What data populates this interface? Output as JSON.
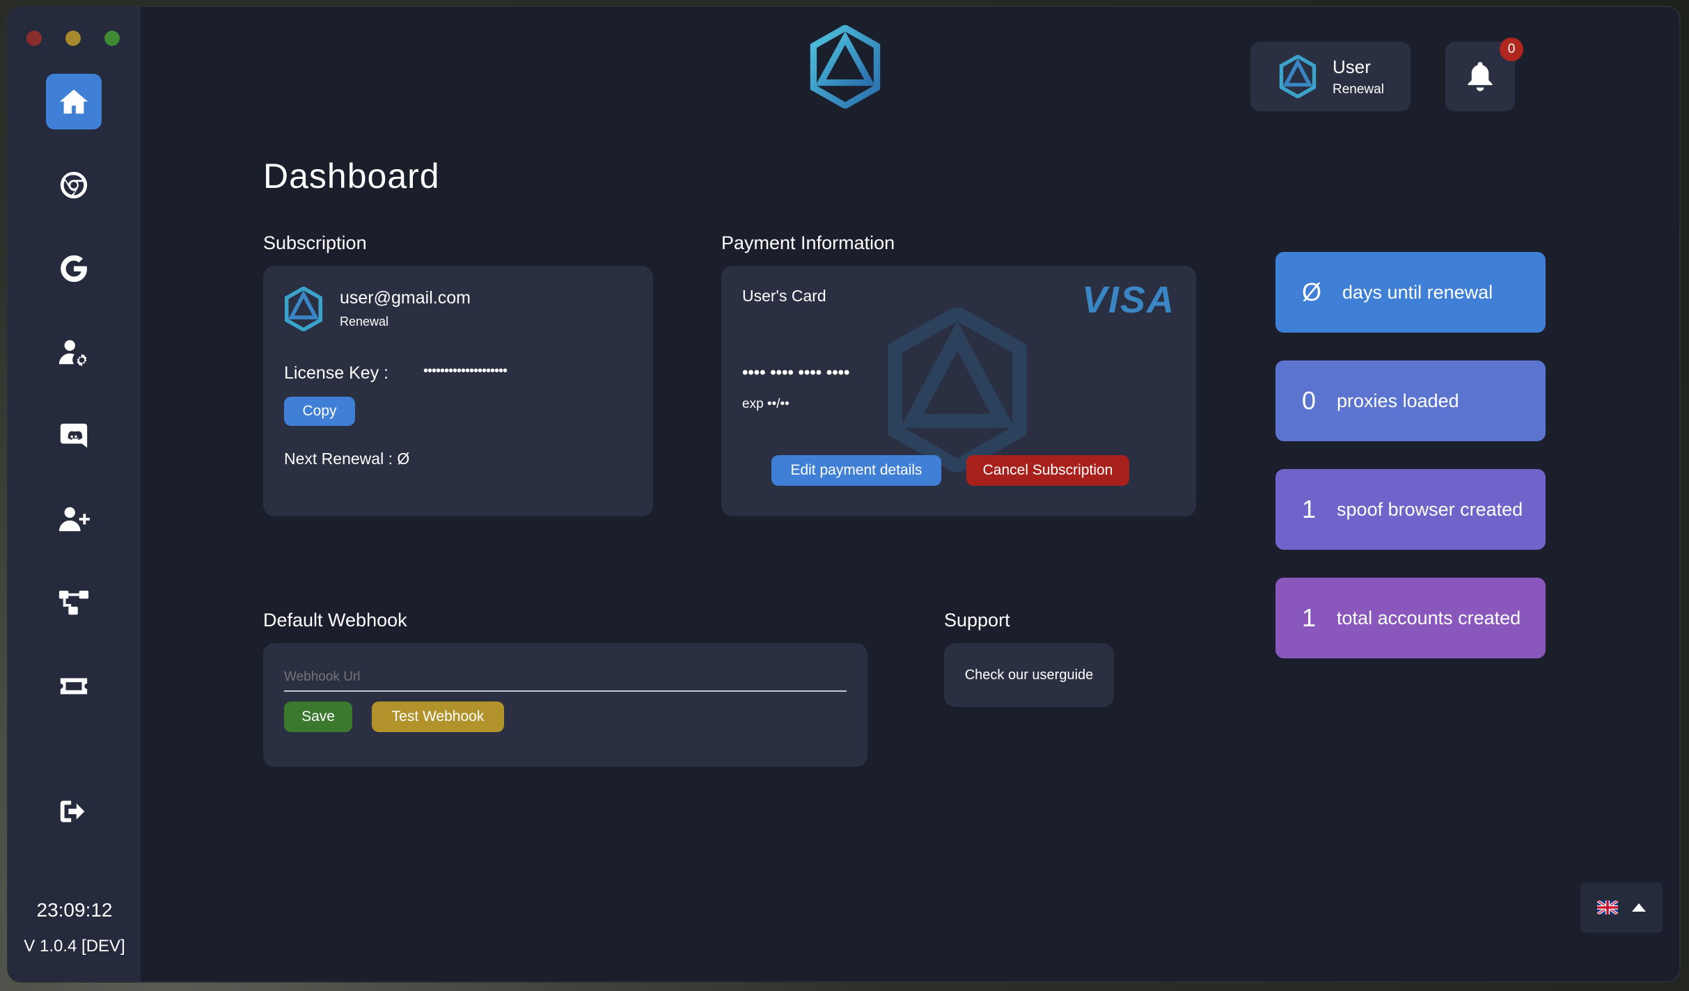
{
  "sidebar": {
    "items": [
      {
        "name": "home",
        "icon": "home-icon",
        "active": true
      },
      {
        "name": "browser",
        "icon": "chrome-icon",
        "active": false
      },
      {
        "name": "google",
        "icon": "google-icon",
        "active": false
      },
      {
        "name": "account-settings",
        "icon": "user-gear-icon",
        "active": false
      },
      {
        "name": "discord",
        "icon": "discord-icon",
        "active": false
      },
      {
        "name": "add-user",
        "icon": "user-plus-icon",
        "active": false
      },
      {
        "name": "workflow",
        "icon": "sitemap-icon",
        "active": false
      },
      {
        "name": "tickets",
        "icon": "ticket-icon",
        "active": false
      },
      {
        "name": "logout",
        "icon": "sign-out-icon",
        "active": false
      }
    ],
    "clock": "23:09:12",
    "version": "V 1.0.4 [DEV]"
  },
  "header": {
    "user_name": "User",
    "user_role": "Renewal",
    "notifications_count": "0"
  },
  "page_title": "Dashboard",
  "subscription": {
    "section_label": "Subscription",
    "email": "user@gmail.com",
    "plan": "Renewal",
    "license_label": "License Key :",
    "license_value": "••••••••••••••••••••",
    "copy_label": "Copy",
    "next_renewal": "Next Renewal : Ø"
  },
  "payment": {
    "section_label": "Payment Information",
    "card_holder": "User's Card",
    "brand": "VISA",
    "card_number": "•••• •••• •••• ••••",
    "expiry": "exp ••/••",
    "edit_label": "Edit payment details",
    "cancel_label": "Cancel Subscription"
  },
  "stats": [
    {
      "value": "Ø",
      "label": "days until renewal",
      "color": "#3f80d6"
    },
    {
      "value": "0",
      "label": "proxies loaded",
      "color": "#5b74cf"
    },
    {
      "value": "1",
      "label": "spoof browser created",
      "color": "#6f64c9"
    },
    {
      "value": "1",
      "label": "total accounts created",
      "color": "#8a58bd"
    }
  ],
  "webhook": {
    "section_label": "Default Webhook",
    "placeholder": "Webhook Url",
    "save_label": "Save",
    "test_label": "Test Webhook"
  },
  "support": {
    "section_label": "Support",
    "button_label": "Check our userguide"
  },
  "language": {
    "flag": "🇬🇧",
    "icon": "caret-up-icon"
  },
  "colors": {
    "accent": "#3f80d6",
    "danger": "#a8201b",
    "success": "#3b7a2e",
    "warning": "#b2922a",
    "background": "#1b1e2b",
    "card": "#2a2f42"
  }
}
